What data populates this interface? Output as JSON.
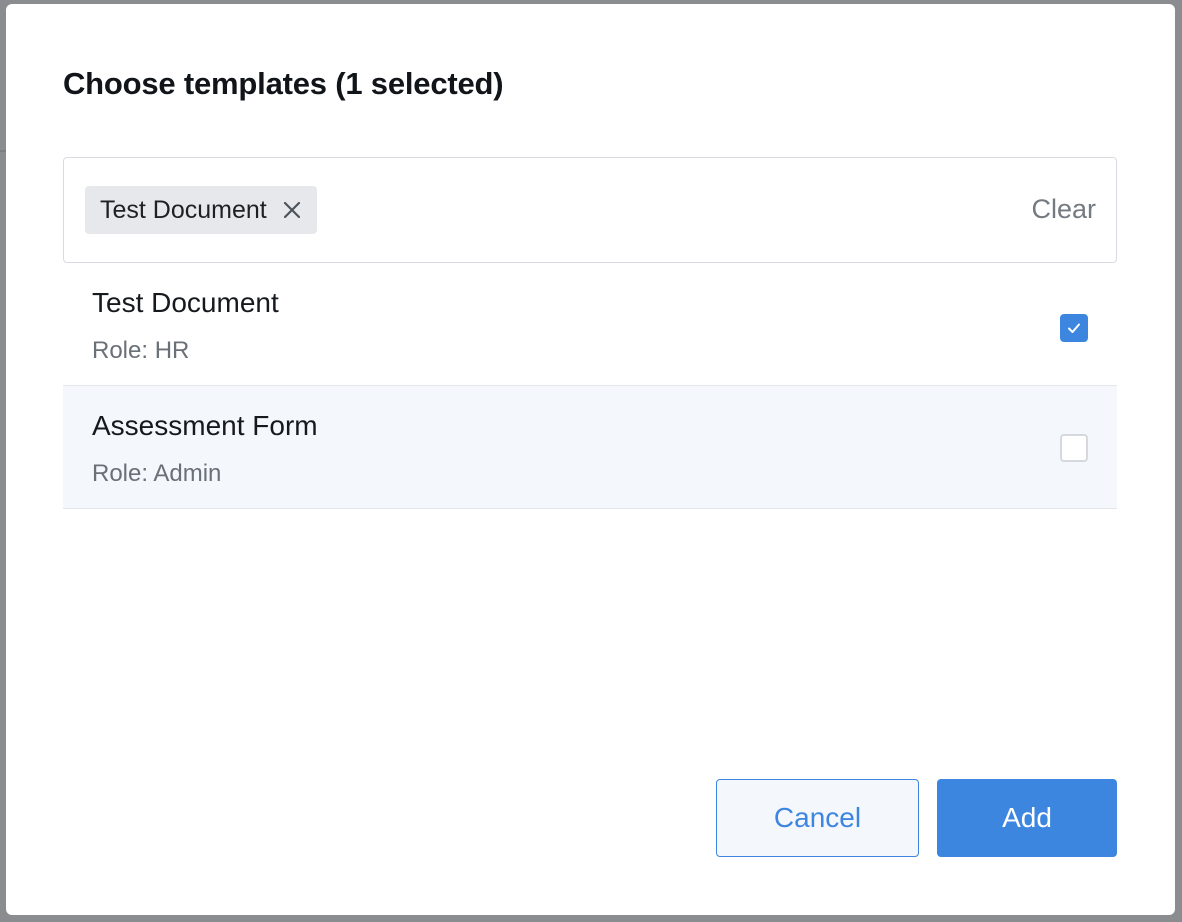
{
  "dialog": {
    "title": "Choose templates (1 selected)"
  },
  "selection": {
    "chips": [
      {
        "label": "Test Document",
        "remove_icon": "close-icon"
      }
    ],
    "clear_label": "Clear"
  },
  "options": [
    {
      "title": "Test Document",
      "role": "Role: HR",
      "checked": true
    },
    {
      "title": "Assessment Form",
      "role": "Role: Admin",
      "checked": false
    }
  ],
  "actions": {
    "cancel_label": "Cancel",
    "add_label": "Add"
  },
  "colors": {
    "accent": "#3d86e0",
    "overlay": "#8a8c8f",
    "chip_bg": "#e6e8eb",
    "alt_row_bg": "#f4f7fb"
  },
  "icons": {
    "checkmark": "check-icon",
    "remove": "close-icon"
  }
}
